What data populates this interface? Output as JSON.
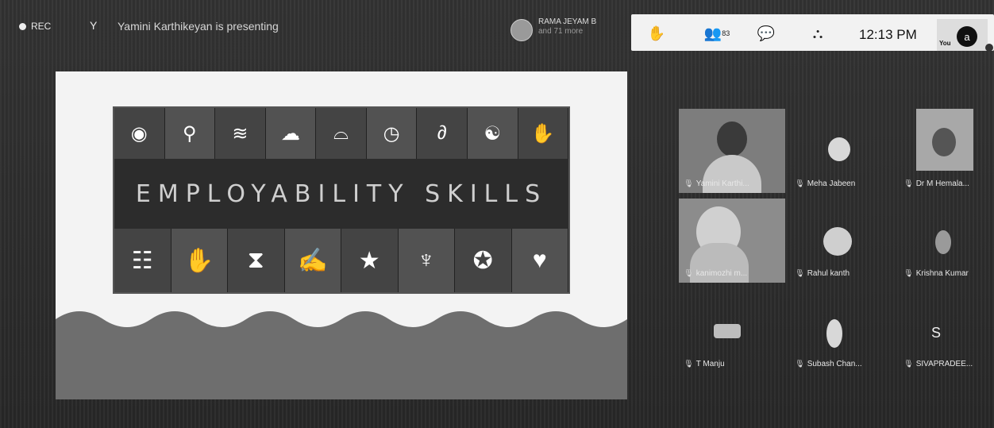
{
  "topbar": {
    "rec_label": "REC",
    "presenter_initial": "Y",
    "presenting_text": "Yamini Karthikeyan is presenting",
    "group_name": "RAMA JEYAM B",
    "group_more": "and 71 more",
    "participants_count": "83",
    "clock": "12:13 PM",
    "you_label": "You",
    "you_initial": "a"
  },
  "icons": {
    "rec": "record-dot-icon",
    "raise_hand": "hand-icon",
    "people": "people-icon",
    "chat": "chat-icon",
    "activities": "activities-icon"
  },
  "slide": {
    "title": "EMPLOYABILITY SKILLS",
    "top_icons": [
      "eye-icon",
      "search-icon",
      "waves-icon",
      "brain-icon",
      "glasses-icon",
      "clock-icon",
      "ear-icon",
      "heads-icon",
      "hand-icon"
    ],
    "bottom_icons": [
      "ladder-icon",
      "hand-icon",
      "hourglass-icon",
      "writing-icon",
      "star-icon",
      "person-icon",
      "award-icon",
      "heart-icon"
    ]
  },
  "participants": [
    {
      "name": "Yamini Karthi...",
      "has_video": true
    },
    {
      "name": "Meha Jabeen",
      "has_video": false
    },
    {
      "name": "Dr M Hemala...",
      "has_video": true
    },
    {
      "name": "kanimozhi m...",
      "has_video": true
    },
    {
      "name": "Rahul kanth",
      "has_video": false
    },
    {
      "name": "Krishna Kumar",
      "has_video": false
    },
    {
      "name": "T Manju",
      "has_video": false
    },
    {
      "name": "Subash Chan...",
      "has_video": false
    },
    {
      "name": "SIVAPRADEE...",
      "has_video": false,
      "initial": "S"
    }
  ],
  "colors": {
    "background": "#2b2b2b",
    "panel": "#f2f2f2",
    "slide_bg": "#f3f3f3",
    "banner": "#2c2c2c"
  }
}
